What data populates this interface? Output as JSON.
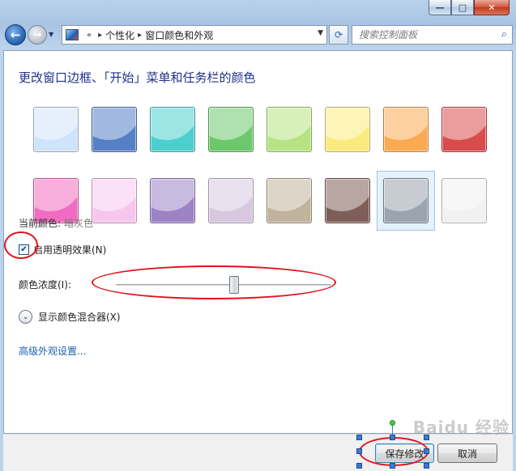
{
  "window": {
    "caption_buttons": {
      "minimize": "—",
      "maximize": "□",
      "close": "✕"
    }
  },
  "nav": {
    "back_icon": "arrow-left-icon",
    "forward_icon": "arrow-right-icon",
    "history_glyph": "▼",
    "address": {
      "crumbs": [
        "个性化",
        "窗口颜色和外观"
      ],
      "overflow": "«",
      "separator": "▸"
    },
    "refresh_glyph": "⟳",
    "search_placeholder": "搜索控制面板"
  },
  "main": {
    "heading": "更改窗口边框、「开始」菜单和任务栏的颜色",
    "swatches": [
      {
        "name": "sky",
        "color": "#cfe3fa"
      },
      {
        "name": "twilight",
        "color": "#5580c6"
      },
      {
        "name": "sea",
        "color": "#4ecfcf"
      },
      {
        "name": "leaf",
        "color": "#6cc86a"
      },
      {
        "name": "lime",
        "color": "#b7e482"
      },
      {
        "name": "pumpkin-yellow",
        "color": "#fbeb7f"
      },
      {
        "name": "tangerine",
        "color": "#fbaa52"
      },
      {
        "name": "ruby",
        "color": "#da4b4b"
      },
      {
        "name": "fuchsia",
        "color": "#f06cc2"
      },
      {
        "name": "blush",
        "color": "#f7c6ee"
      },
      {
        "name": "violet",
        "color": "#9c82c6"
      },
      {
        "name": "lavender",
        "color": "#d8c8df"
      },
      {
        "name": "taupe",
        "color": "#c1b39c"
      },
      {
        "name": "chocolate",
        "color": "#7e5e58"
      },
      {
        "name": "slate",
        "color": "#9aa3ae"
      },
      {
        "name": "frost",
        "color": "#f1f1f1"
      }
    ],
    "selected_index": 14,
    "current_color_label": "当前颜色:",
    "current_color_value": "暗灰色",
    "transparency_label": "启用透明效果(N)",
    "transparency_checked": true,
    "check_glyph": "✔",
    "intensity_label": "颜色浓度(I):",
    "intensity_level": 0.55,
    "mixer_label": "显示颜色混合器(X)",
    "mixer_glyph": "⌄",
    "advanced_link": "高级外观设置..."
  },
  "footer": {
    "save_label": "保存修改",
    "cancel_label": "取消"
  },
  "watermark": "Baidu 经验",
  "annotation_color": "#e0141b"
}
